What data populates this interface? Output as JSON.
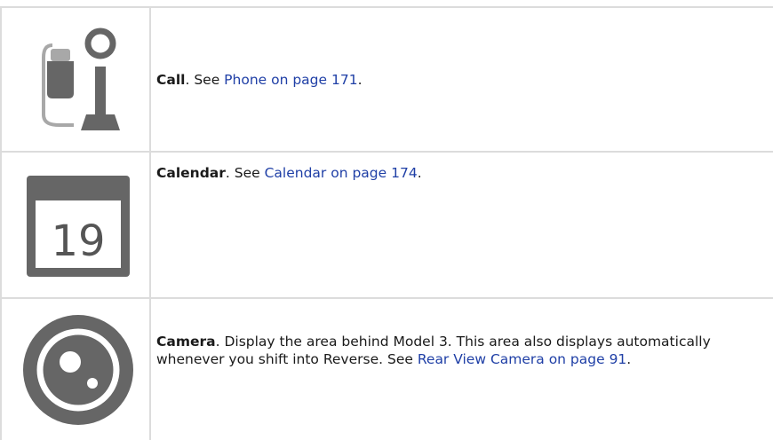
{
  "rows": [
    {
      "icon": "phone-call-icon",
      "term": "Call",
      "text": ". See ",
      "link": "Phone on page 171",
      "after": "."
    },
    {
      "icon": "calendar-icon",
      "icon_number": "19",
      "term": "Calendar",
      "text": ". See ",
      "link": "Calendar on page 174",
      "after": "."
    },
    {
      "icon": "camera-icon",
      "term": "Camera",
      "text": ". Display the area behind Model 3. This area also displays automatically whenever you shift into Reverse. See ",
      "link": "Rear View Camera on page 91",
      "after": "."
    }
  ],
  "colors": {
    "border": "#dcdcdc",
    "icon_gray": "#666666",
    "link": "#1f3fa6"
  }
}
